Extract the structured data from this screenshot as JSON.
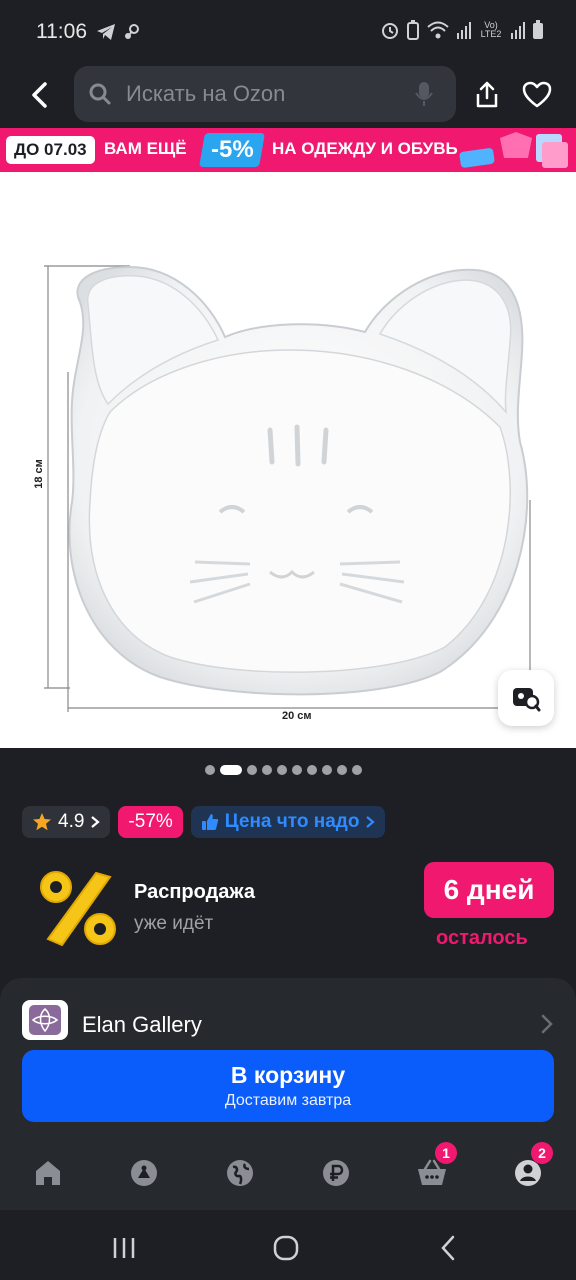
{
  "status": {
    "time": "11:06",
    "network": "Vo) LTE2"
  },
  "search": {
    "placeholder": "Искать на Ozon"
  },
  "promo": {
    "date": "ДО 07.03",
    "text1": "ВАМ ЕЩЁ",
    "discount": "-5%",
    "text2": "НА ОДЕЖДУ И ОБУВЬ"
  },
  "product_image": {
    "height_label": "18 см",
    "width_label": "20 см",
    "current_slide": 2,
    "total_slides": 10
  },
  "badges": {
    "rating": "4.9",
    "discount": "-57%",
    "price_label": "Цена что надо"
  },
  "sale": {
    "title": "Распродажа",
    "subtitle": "уже идёт",
    "days": "6 дней",
    "days_caption": "осталось"
  },
  "seller": {
    "name": "Elan Gallery"
  },
  "cart": {
    "label": "В корзину",
    "sub": "Доставим завтра"
  },
  "tabbar": {
    "cart_count": "1",
    "profile_count": "2"
  },
  "colors": {
    "accent": "#f0196f",
    "primary": "#0a5dfb",
    "background": "#1d1f24"
  }
}
